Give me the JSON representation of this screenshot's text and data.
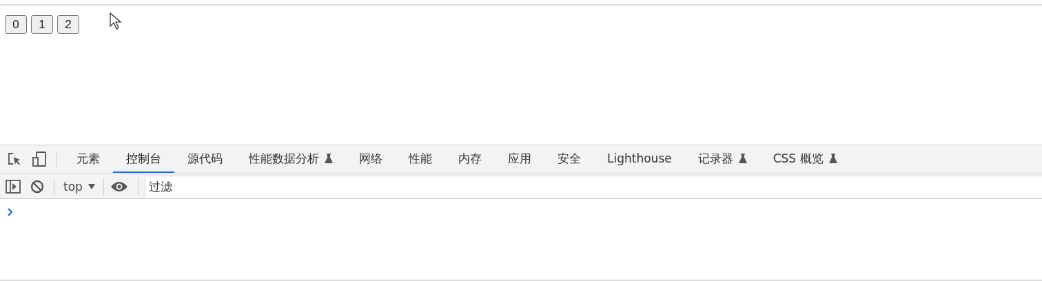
{
  "page_buttons": [
    "0",
    "1",
    "2"
  ],
  "devtools": {
    "tabs": [
      {
        "label": "元素",
        "selected": false,
        "experimental": false
      },
      {
        "label": "控制台",
        "selected": true,
        "experimental": false
      },
      {
        "label": "源代码",
        "selected": false,
        "experimental": false
      },
      {
        "label": "性能数据分析",
        "selected": false,
        "experimental": true
      },
      {
        "label": "网络",
        "selected": false,
        "experimental": false
      },
      {
        "label": "性能",
        "selected": false,
        "experimental": false
      },
      {
        "label": "内存",
        "selected": false,
        "experimental": false
      },
      {
        "label": "应用",
        "selected": false,
        "experimental": false
      },
      {
        "label": "安全",
        "selected": false,
        "experimental": false
      },
      {
        "label": "Lighthouse",
        "selected": false,
        "experimental": false
      },
      {
        "label": "记录器",
        "selected": false,
        "experimental": true
      },
      {
        "label": "CSS 概览",
        "selected": false,
        "experimental": true
      }
    ],
    "context": "top",
    "filter": {
      "placeholder": "过滤"
    }
  }
}
